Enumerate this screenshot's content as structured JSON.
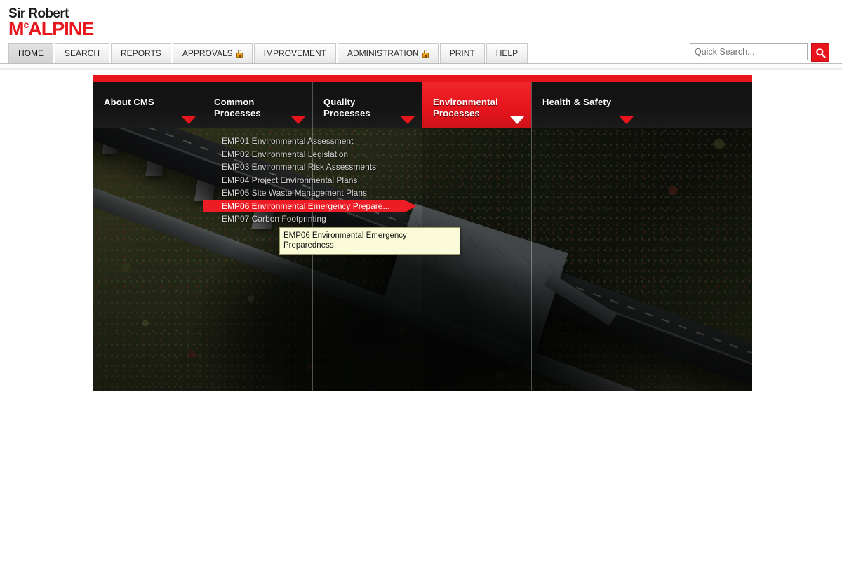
{
  "brand": {
    "line1": "Sir Robert",
    "line2_pre": "M",
    "line2_sup": "c",
    "line2_post": "ALPINE"
  },
  "topnav": {
    "items": [
      {
        "label": "HOME",
        "active": true,
        "locked": false
      },
      {
        "label": "SEARCH",
        "active": false,
        "locked": false
      },
      {
        "label": "REPORTS",
        "active": false,
        "locked": false
      },
      {
        "label": "APPROVALS",
        "active": false,
        "locked": true
      },
      {
        "label": "IMPROVEMENT",
        "active": false,
        "locked": false
      },
      {
        "label": "ADMINISTRATION",
        "active": false,
        "locked": true
      },
      {
        "label": "PRINT",
        "active": false,
        "locked": false
      },
      {
        "label": "HELP",
        "active": false,
        "locked": false
      }
    ]
  },
  "search": {
    "placeholder": "Quick Search...",
    "value": "",
    "icon": "search-icon",
    "button_color": "#e8151d"
  },
  "mega_menu": {
    "accent_color": "#e8151d",
    "tabs": [
      {
        "label": "About CMS",
        "active": false,
        "caret": "chevron-down-icon"
      },
      {
        "label": "Common Processes",
        "active": false,
        "caret": "chevron-down-icon"
      },
      {
        "label": "Quality Processes",
        "active": false,
        "caret": "chevron-down-icon"
      },
      {
        "label": "Environmental Processes",
        "active": true,
        "caret": "chevron-down-icon"
      },
      {
        "label": "Health & Safety",
        "active": false,
        "caret": "chevron-down-icon"
      }
    ],
    "dropdown": {
      "items": [
        {
          "label": "EMP01 Environmental Assessment",
          "selected": false
        },
        {
          "label": "EMP02 Environmental Legislation",
          "selected": false
        },
        {
          "label": "EMP03 Environmental Risk Assessments",
          "selected": false
        },
        {
          "label": "EMP04 Project Environmental Plans",
          "selected": false
        },
        {
          "label": "EMP05 Site Waste Management Plans",
          "selected": false
        },
        {
          "label": "EMP06 Environmental Emergency Prepare...",
          "selected": true
        },
        {
          "label": "EMP07 Carbon Footprinting",
          "selected": false
        }
      ]
    },
    "tooltip": {
      "text": "EMP06 Environmental Emergency Preparedness"
    }
  }
}
